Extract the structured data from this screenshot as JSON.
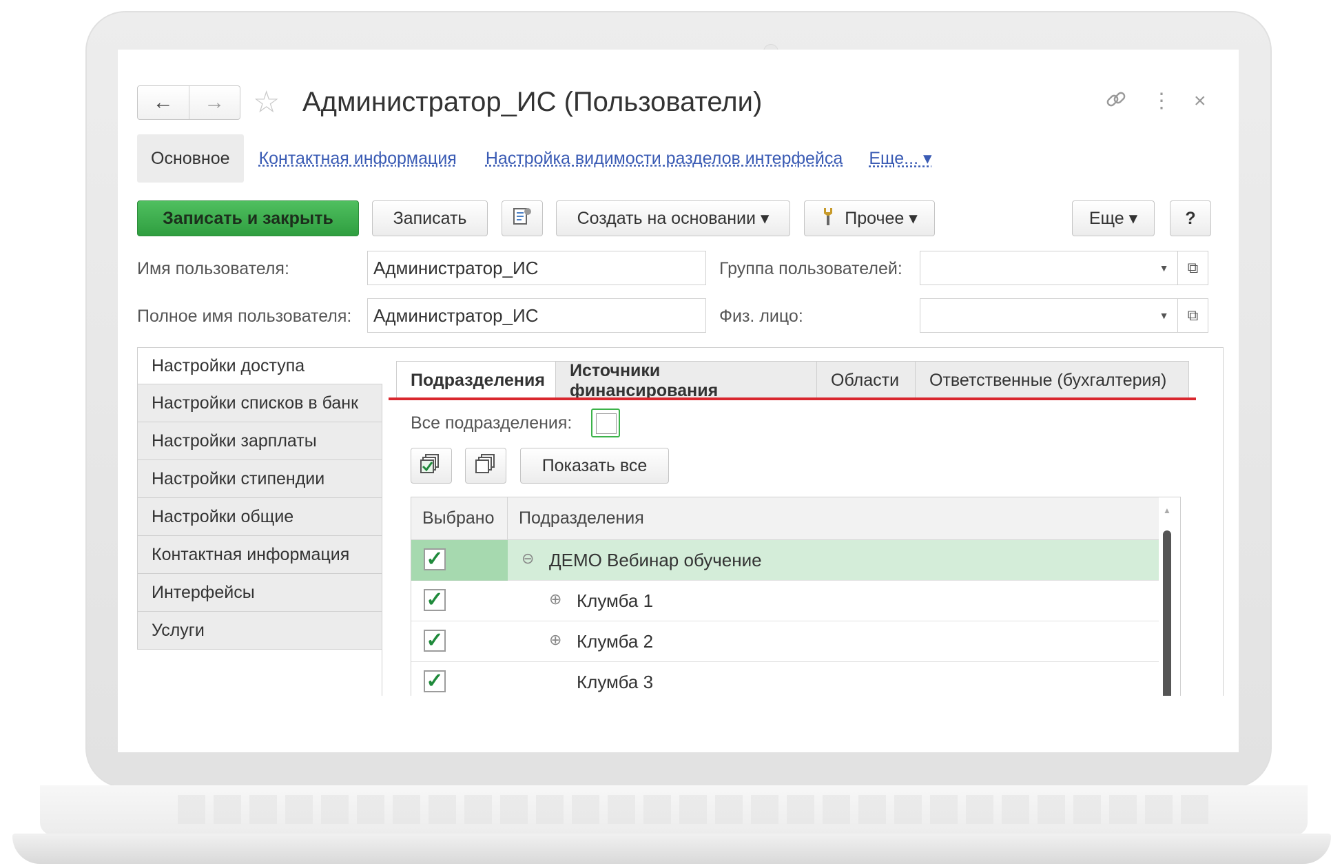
{
  "window": {
    "title": "Администратор_ИС (Пользователи)",
    "nav_back": "←",
    "nav_forward": "→",
    "star": "☆",
    "link_icon": "🔗",
    "menu_icon": "⋮",
    "close_icon": "×"
  },
  "sections": {
    "main": "Основное",
    "contact": "Контактная информация",
    "visibility": "Настройка видимости разделов интерфейса",
    "more": "Еще... ▾"
  },
  "toolbar": {
    "save_close": "Записать и закрыть",
    "save": "Записать",
    "create_based": "Создать на основании ▾",
    "other": "Прочее ▾",
    "more": "Еще ▾",
    "help": "?"
  },
  "fields": {
    "username_label": "Имя пользователя:",
    "username_value": "Администратор_ИС",
    "fullname_label": "Полное имя пользователя:",
    "fullname_value": "Администратор_ИС",
    "group_label": "Группа пользователей:",
    "group_value": "",
    "person_label": "Физ. лицо:",
    "person_value": ""
  },
  "left_menu": [
    "Настройки доступа",
    "Настройки списков в банк",
    "Настройки зарплаты",
    "Настройки стипендии",
    "Настройки общие",
    "Контактная информация",
    "Интерфейсы",
    "Услуги"
  ],
  "tabs": [
    "Подразделения",
    "Источники финансирования",
    "Области",
    "Ответственные (бухгалтерия)"
  ],
  "all_departments_label": "Все подразделения:",
  "show_all_button": "Показать все",
  "table": {
    "col_selected": "Выбрано",
    "col_departments": "Подразделения",
    "rows": [
      {
        "checked": "✓",
        "tree": "⊖",
        "name": "ДЕМО Вебинар обучение"
      },
      {
        "checked": "✓",
        "tree": "⊕",
        "name": "Клумба 1"
      },
      {
        "checked": "✓",
        "tree": "⊕",
        "name": "Клумба 2"
      },
      {
        "checked": "✓",
        "tree": "",
        "name": "Клумба 3"
      }
    ]
  },
  "colors": {
    "accent_green": "#3cb34a",
    "active_tab_line": "#d9272e",
    "link_blue": "#3a5bb4"
  }
}
